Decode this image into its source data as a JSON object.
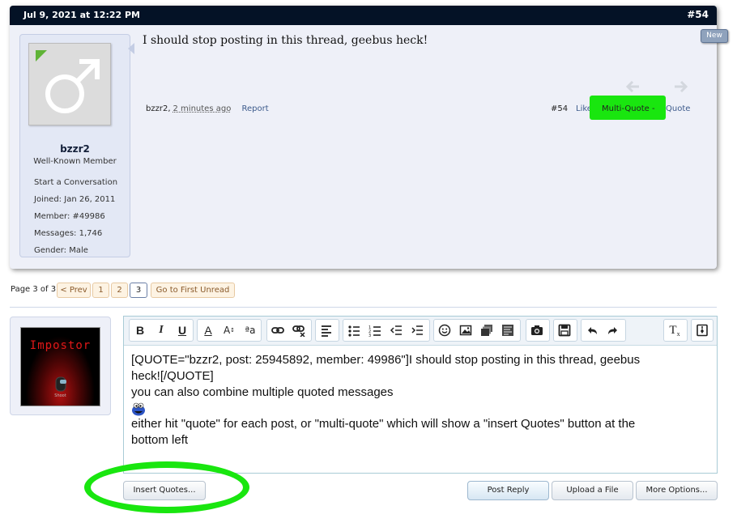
{
  "post": {
    "date": "Jul 9, 2021 at 12:22 PM",
    "number": "#54",
    "message": "I should stop posting in this thread, geebus heck!",
    "author": "bzzr2",
    "time_ago": "2 minutes ago",
    "report": "Report",
    "post_num": "#54",
    "like": "Like",
    "multi_quote": "Multi-Quote -",
    "quote": "Quote",
    "new_badge": "New"
  },
  "user": {
    "name": "bzzr2",
    "title": "Well-Known Member",
    "start_conversation": "Start a Conversation",
    "joined_label": "Joined:",
    "joined_value": "Jan 26, 2011",
    "member_label": "Member:",
    "member_value": "#49986",
    "messages_label": "Messages:",
    "messages_value": "1,746",
    "gender_label": "Gender:",
    "gender_value": "Male"
  },
  "pagination": {
    "label": "Page 3 of 3",
    "prev": "< Prev",
    "pages": [
      "1",
      "2",
      "3"
    ],
    "first_unread": "Go to First Unread"
  },
  "my_avatar": {
    "title": "Impostor",
    "caption": "Shoot"
  },
  "editor": {
    "lines": [
      "[QUOTE=\"bzzr2, post: 25945892, member: 49986\"]I should stop posting in this thread, geebus",
      "heck![/QUOTE]",
      "you can also combine multiple quoted messages",
      "either hit \"quote\" for each post, or \"multi-quote\" which will show a \"insert Quotes\" button at the",
      "bottom left"
    ]
  },
  "buttons": {
    "insert_quotes": "Insert Quotes...",
    "post_reply": "Post Reply",
    "upload_file": "Upload a File",
    "more_options": "More Options..."
  },
  "colors": {
    "header_bg": "#041226",
    "highlight_green": "#19e60f",
    "link_blue": "#3d5b8c"
  }
}
